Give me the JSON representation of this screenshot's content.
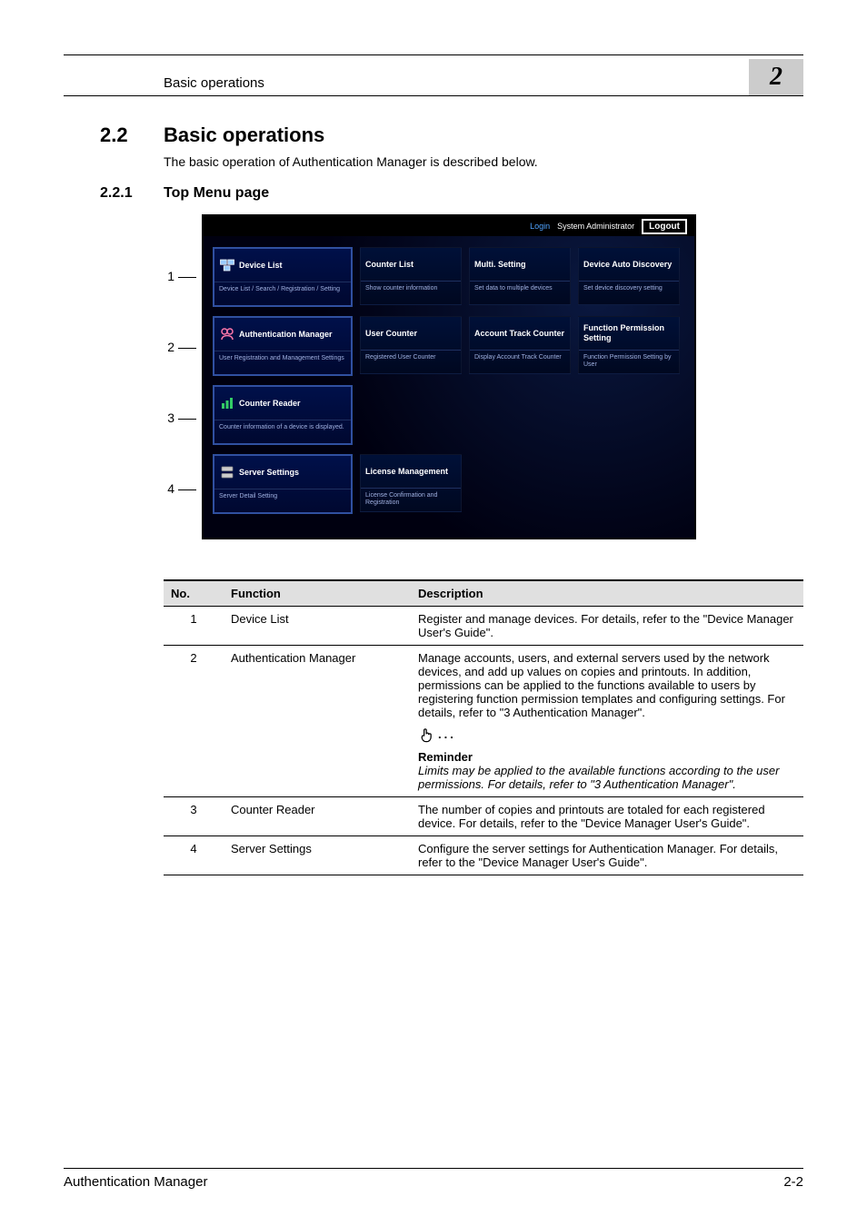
{
  "header": {
    "runningTitle": "Basic operations",
    "chapterNum": "2"
  },
  "section": {
    "num": "2.2",
    "title": "Basic operations",
    "intro": "The basic operation of Authentication Manager is described below."
  },
  "subsection": {
    "num": "2.2.1",
    "title": "Top Menu page"
  },
  "callouts": [
    "1",
    "2",
    "3",
    "4"
  ],
  "screenshot": {
    "loginLabel": "Login",
    "role": "System Administrator",
    "logout": "Logout",
    "rows": [
      {
        "big": {
          "title": "Device List",
          "sub": "Device List / Search / Registration / Setting",
          "icon": "device-list-icon"
        },
        "small": [
          {
            "title": "Counter List",
            "sub": "Show counter information"
          },
          {
            "title": "Multi. Setting",
            "sub": "Set data to multiple devices"
          },
          {
            "title": "Device Auto Discovery",
            "sub": "Set device discovery setting"
          }
        ]
      },
      {
        "big": {
          "title": "Authentication Manager",
          "sub": "User Registration and Management Settings",
          "icon": "auth-manager-icon"
        },
        "small": [
          {
            "title": "User Counter",
            "sub": "Registered User Counter"
          },
          {
            "title": "Account Track Counter",
            "sub": "Display Account Track Counter"
          },
          {
            "title": "Function Permission Setting",
            "sub": "Function Permission Setting by User"
          }
        ]
      },
      {
        "big": {
          "title": "Counter Reader",
          "sub": "Counter information of a device is displayed.",
          "icon": "counter-reader-icon"
        },
        "small": []
      },
      {
        "big": {
          "title": "Server Settings",
          "sub": "Server Detail Setting",
          "icon": "server-settings-icon"
        },
        "small": [
          {
            "title": "License Management",
            "sub": "License Confirmation and Registration"
          }
        ]
      }
    ]
  },
  "table": {
    "headers": {
      "no": "No.",
      "fn": "Function",
      "desc": "Description"
    },
    "rows": [
      {
        "no": "1",
        "fn": "Device List",
        "desc": "Register and manage devices. For details, refer to the \"Device Manager User's Guide\"."
      },
      {
        "no": "2",
        "fn": "Authentication Manager",
        "desc": "Manage accounts, users, and external servers used by the network devices, and add up values on copies and printouts. In addition, permissions can be applied to the functions available to users by registering function permission templates and configuring settings. For details, refer to \"3 Authentication Manager\".",
        "reminderTitle": "Reminder",
        "reminderBody": "Limits may be applied to the available functions according to the user permissions. For details, refer to \"3 Authentication Manager\"."
      },
      {
        "no": "3",
        "fn": "Counter Reader",
        "desc": "The number of copies and printouts are totaled for each registered device. For details, refer to the \"Device Manager User's Guide\"."
      },
      {
        "no": "4",
        "fn": "Server Settings",
        "desc": "Configure the server settings for Authentication Manager. For details, refer to the \"Device Manager User's Guide\"."
      }
    ]
  },
  "footer": {
    "left": "Authentication Manager",
    "right": "2-2"
  }
}
